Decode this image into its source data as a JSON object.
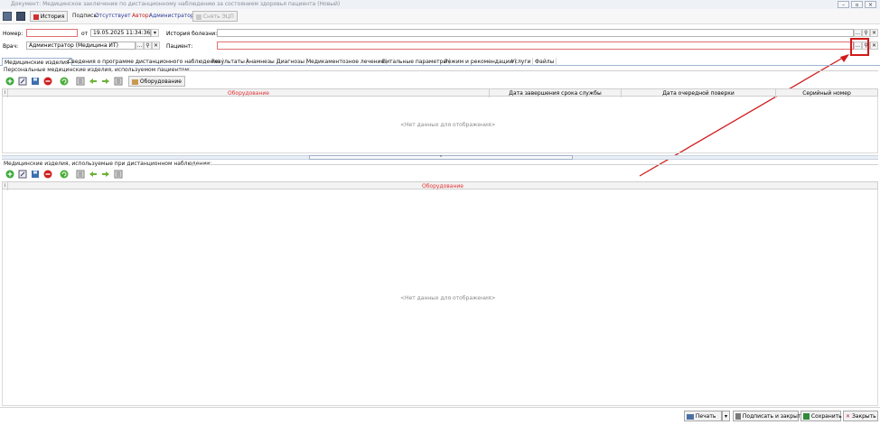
{
  "window": {
    "title": "Документ: Медицинское заключение по дистанционному наблюдению за состоянием здоровья пациента (Новый)"
  },
  "toolbar": {
    "history_label": "История",
    "signature_label": "Подпись:",
    "signature_value": "Отсутствует",
    "author_label": "Автор:",
    "author_value": "Администратор",
    "remove_ecp_label": "Снять ЭЦП"
  },
  "form": {
    "number_label": "Номер:",
    "number_value": "",
    "from_label": "от",
    "date_value": "19.05.2025 11:34:36",
    "history_label": "История болезни:",
    "history_value": "",
    "doctor_label": "Врач:",
    "doctor_value": "Администратор (Медицина ИТ)",
    "patient_label": "Пациент:",
    "patient_value": ""
  },
  "tabs": [
    {
      "label": "Медицинские изделия"
    },
    {
      "label": "Сведения о программе дистанционного наблюдения"
    },
    {
      "label": "Результаты"
    },
    {
      "label": "Анамнезы"
    },
    {
      "label": "Диагнозы"
    },
    {
      "label": "Медикаментозное лечение"
    },
    {
      "label": "Витальные параметры"
    },
    {
      "label": "Режим и рекомендации"
    },
    {
      "label": "Услуги"
    },
    {
      "label": "Файлы"
    }
  ],
  "personal_devices": {
    "title": "Персональные медицинские изделия, используемом пациентом:",
    "equipment_button": "Оборудование",
    "columns": [
      "Оборудование",
      "Дата завершения срока службы",
      "Дата очередной поверки",
      "Серийный номер"
    ],
    "empty_text": "<Нет данных для отображения>"
  },
  "remote_devices": {
    "title": "Медицинские изделия, используемые при дистанционном наблюдении:",
    "columns": [
      "Оборудование"
    ],
    "empty_text": "<Нет данных для отображения>"
  },
  "footer": {
    "print_label": "Печать",
    "sign_close_label": "Подписать и закрыть",
    "save_label": "Сохранить",
    "close_label": "Закрыть"
  },
  "colors": {
    "required": "#e23030",
    "annotation": "#d11a1a",
    "tab_border": "#9fb4d0",
    "accent_green": "#3aa83a",
    "accent_red": "#d02020"
  },
  "icons": {
    "add": "plus-green-icon",
    "edit": "edit-icon",
    "save": "save-icon",
    "delete": "delete-red-icon",
    "refresh": "refresh-icon",
    "arrow_left": "arrow-left-icon",
    "arrow_right": "arrow-right-icon"
  }
}
